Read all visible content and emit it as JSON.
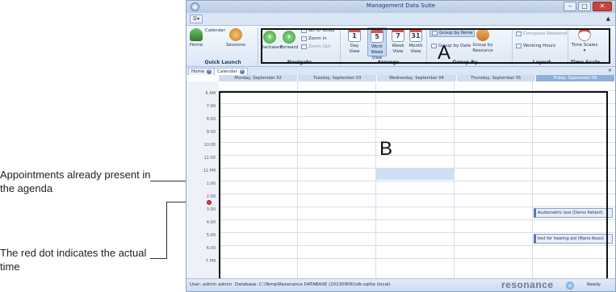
{
  "window": {
    "title": "Management Data Suite",
    "min": "–",
    "max": "□",
    "close": "✕",
    "qat": "☰▾",
    "help": "▲"
  },
  "ribbon": {
    "home": "Home",
    "calendar": "Calendar",
    "sessions": "Sessions",
    "backward": "Backward",
    "forward": "Forward",
    "go_today": "Go to Today",
    "zoom_in": "Zoom In",
    "zoom_out": "Zoom Out",
    "day_view": "Day View",
    "work_week_view": "Work Week View",
    "week_view": "Week View",
    "month_view": "Month View",
    "day_num": "1",
    "week_num": "5",
    "wk_num": "7",
    "month_num": "31",
    "cal_num": "31",
    "group_none": "Group by None",
    "group_date": "Group by Date",
    "group_resource": "Group by Resource",
    "compress_weekend": "Compress Weekend",
    "working_hours": "Working Hours",
    "time_scales": "Time Scales ▾",
    "groups": {
      "quick_launch": "Quick Launch",
      "navigate": "Navigate",
      "arrange": "Arrange",
      "group_by": "Group By",
      "layout": "Layout",
      "time_scale": "Time Scale"
    }
  },
  "tabs": [
    {
      "label": "Home"
    },
    {
      "label": "Calendar"
    }
  ],
  "doc_close": "✕",
  "days": [
    "Monday, September 02",
    "Tuesday, September 03",
    "Wednesday, September 04",
    "Thursday, September 05",
    "Friday, September 06"
  ],
  "times": [
    "6 AM",
    "7:00",
    "8:00",
    "9:00",
    "10:00",
    "11:00",
    "12 PM",
    "1:00",
    "2:00",
    "3:00",
    "4:00",
    "5:00",
    "6:00",
    "7 PM"
  ],
  "appointments": [
    {
      "text": "Audiometric test (Demo Patient)"
    },
    {
      "text": "test for hearing aid (Mario Rossi)"
    }
  ],
  "status": {
    "user": "User: admin admin",
    "database": "Database: C:\\Temp\\Resonance DATABASE (20130906)\\db.sqlite (local)",
    "brand": "resonance",
    "ready": "Ready"
  },
  "labels": {
    "a": "A",
    "b": "B"
  },
  "annotations": {
    "appointments": "Appointments already present in the agenda",
    "red_dot": "The red dot indicates the actual time"
  },
  "colors": {
    "accent": "#8fb0dc",
    "red_dot": "#e23b3b"
  }
}
